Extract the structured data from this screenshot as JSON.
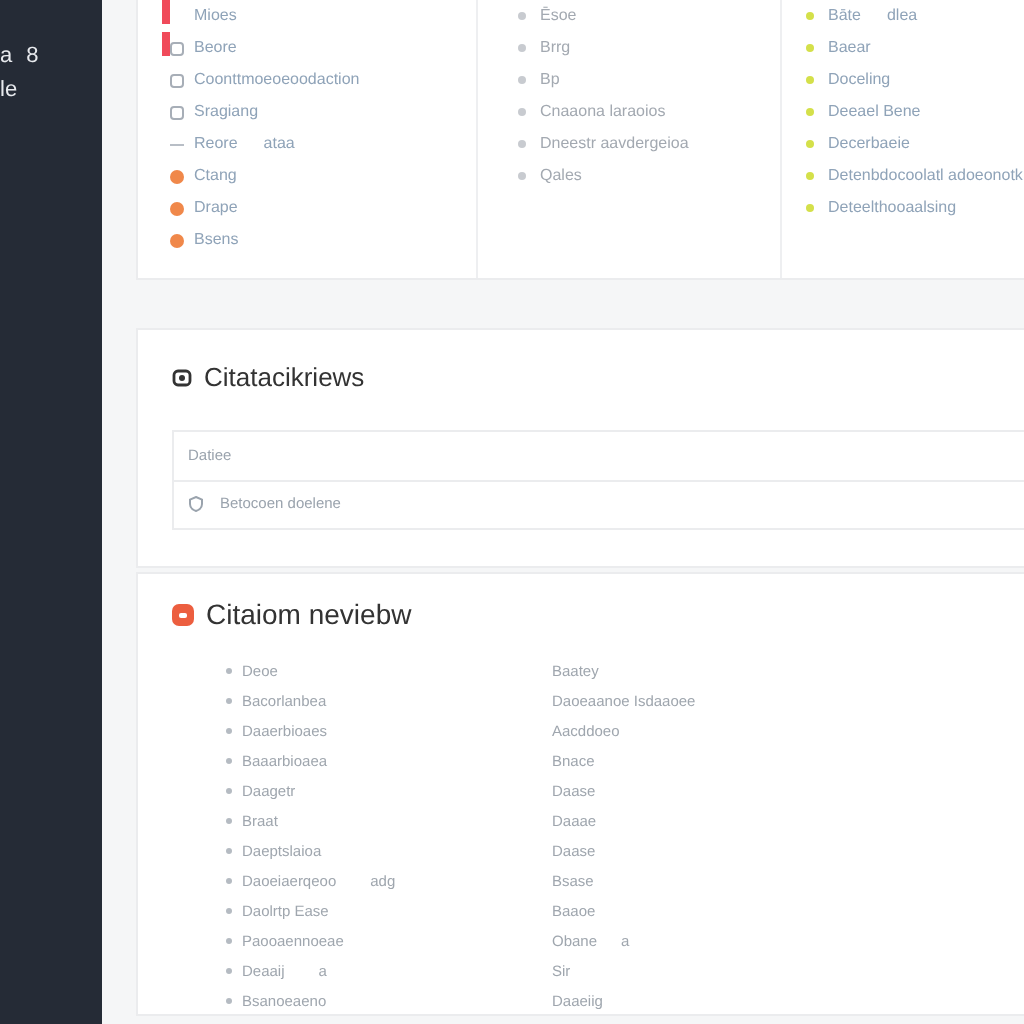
{
  "sidebar": {
    "items": [
      {
        "label": "a"
      },
      {
        "label": "8"
      },
      {
        "label": "le"
      }
    ]
  },
  "filters": {
    "columns": [
      {
        "items": [
          {
            "kind": "plain",
            "label": "Mioes",
            "flagged": true
          },
          {
            "kind": "checkbox",
            "label": "Beore",
            "flagged": true,
            "checked": false
          },
          {
            "kind": "checkbox",
            "label": "Coonttmoeoeoodaction",
            "flagged": false,
            "checked": false
          },
          {
            "kind": "checkbox",
            "label": "Sragiang",
            "flagged": false,
            "checked": false
          },
          {
            "kind": "dash",
            "label": "Reore",
            "note": "ataa",
            "flagged": false
          },
          {
            "kind": "dot",
            "label": "Ctang",
            "flagged": false,
            "color": "#f0884a"
          },
          {
            "kind": "dot",
            "label": "Drape",
            "flagged": false,
            "color": "#f0884a"
          },
          {
            "kind": "dot",
            "label": "Bsens",
            "flagged": false,
            "color": "#f0884a"
          }
        ]
      },
      {
        "items": [
          {
            "kind": "dot",
            "label": "Ēsoe",
            "color": "#c8cbd0"
          },
          {
            "kind": "dot",
            "label": "Brrg",
            "color": "#c8cbd0"
          },
          {
            "kind": "dot",
            "label": "Bp",
            "color": "#c8cbd0"
          },
          {
            "kind": "dot",
            "label": "Cnaaona laraoios",
            "color": "#c8cbd0"
          },
          {
            "kind": "dot",
            "label": "Dneestr aavdergeioa",
            "color": "#c8cbd0"
          },
          {
            "kind": "dot",
            "label": "Qales",
            "color": "#c8cbd0"
          }
        ]
      },
      {
        "items": [
          {
            "kind": "dot",
            "label": "Bāte",
            "note": "dlea",
            "color": "#d4e04a"
          },
          {
            "kind": "dot",
            "label": "Baear",
            "color": "#d4e04a"
          },
          {
            "kind": "dot",
            "label": "Doceling",
            "color": "#d4e04a"
          },
          {
            "kind": "dot",
            "label": "Deeael Bene",
            "color": "#d4e04a"
          },
          {
            "kind": "dot",
            "label": "Decerbaeie",
            "color": "#d4e04a"
          },
          {
            "kind": "dot",
            "label": "Detenbdocoolatl adoeonotk",
            "color": "#d4e04a"
          },
          {
            "kind": "dot",
            "label": "Deteelthooaalsing",
            "color": "#d4e04a"
          }
        ]
      }
    ]
  },
  "reviews": {
    "title": "Citatacikriews",
    "table": {
      "header": "Datiee",
      "rows": [
        {
          "label": "Betocoen doelene"
        }
      ]
    }
  },
  "citation_review": {
    "title": "Citaiom neviebw",
    "rows": [
      {
        "left": "Deoe",
        "right": "Baatey"
      },
      {
        "left": "Bacorlanbea",
        "right": "Daoeaanoe Isdaaoee"
      },
      {
        "left": "Daaerbioaes",
        "right": "Aacddoeo"
      },
      {
        "left": "Baaarbioaea",
        "right": "Bnace"
      },
      {
        "left": "Daagetr",
        "right": "Daase"
      },
      {
        "left": "Braat",
        "right": "Daaae"
      },
      {
        "left": "Daeptslaioa",
        "right": "Daase"
      },
      {
        "left": "Daoeiaerqeoo",
        "left_note": "adg",
        "right": "Bsase"
      },
      {
        "left": "Daolrtp Ease",
        "right": "Baaoe"
      },
      {
        "left": "Paooaennoeae",
        "right": "Obane",
        "right_note": "a"
      },
      {
        "left": "Deaaij",
        "left_note": "a",
        "right": "Sir"
      },
      {
        "left": "Bsanoeaeno",
        "right": "Daaeiig"
      }
    ]
  }
}
